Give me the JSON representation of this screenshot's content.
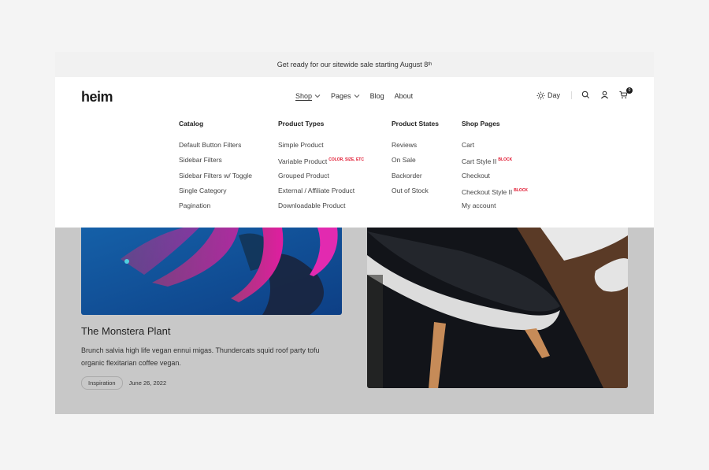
{
  "announcement": {
    "text": "Get ready for our sitewide sale starting August 8",
    "sup": "th"
  },
  "header": {
    "logo": "heim",
    "nav": [
      {
        "label": "Shop",
        "has_dropdown": true,
        "active": true
      },
      {
        "label": "Pages",
        "has_dropdown": true,
        "active": false
      },
      {
        "label": "Blog",
        "has_dropdown": false,
        "active": false
      },
      {
        "label": "About",
        "has_dropdown": false,
        "active": false
      }
    ],
    "theme_toggle": {
      "label": "Day",
      "icon": "sun-icon"
    },
    "icons": [
      "search-icon",
      "user-icon",
      "cart-icon"
    ],
    "cart_count": "0"
  },
  "mega_menu": {
    "columns": [
      {
        "title": "Catalog",
        "links": [
          {
            "label": "Default Button Filters"
          },
          {
            "label": "Sidebar Filters"
          },
          {
            "label": "Sidebar Filters w/ Toggle"
          },
          {
            "label": "Single Category"
          },
          {
            "label": "Pagination"
          }
        ]
      },
      {
        "title": "Product Types",
        "links": [
          {
            "label": "Simple Product"
          },
          {
            "label": "Variable Product",
            "tag": "COLOR, SIZE, ETC"
          },
          {
            "label": "Grouped Product"
          },
          {
            "label": "External / Affiliate Product"
          },
          {
            "label": "Downloadable Product"
          }
        ]
      },
      {
        "title": "Product States",
        "links": [
          {
            "label": "Reviews"
          },
          {
            "label": "On Sale"
          },
          {
            "label": "Backorder"
          },
          {
            "label": "Out of Stock"
          }
        ]
      },
      {
        "title": "Shop Pages",
        "links": [
          {
            "label": "Cart"
          },
          {
            "label": "Cart Style II",
            "tag": "BLOCK"
          },
          {
            "label": "Checkout"
          },
          {
            "label": "Checkout Style II",
            "tag": "BLOCK"
          },
          {
            "label": "My account"
          }
        ]
      }
    ],
    "tag_color": "#e0102a"
  },
  "posts": [
    {
      "title": "The Monstera Plant",
      "excerpt": "Brunch salvia high life vegan ennui migas. Thundercats squid roof party tofu organic flexitarian coffee vegan.",
      "category": "Inspiration",
      "date": "June 26, 2022",
      "image": "monstera-leaf-photo"
    },
    {
      "image": "white-chair-photo"
    }
  ]
}
